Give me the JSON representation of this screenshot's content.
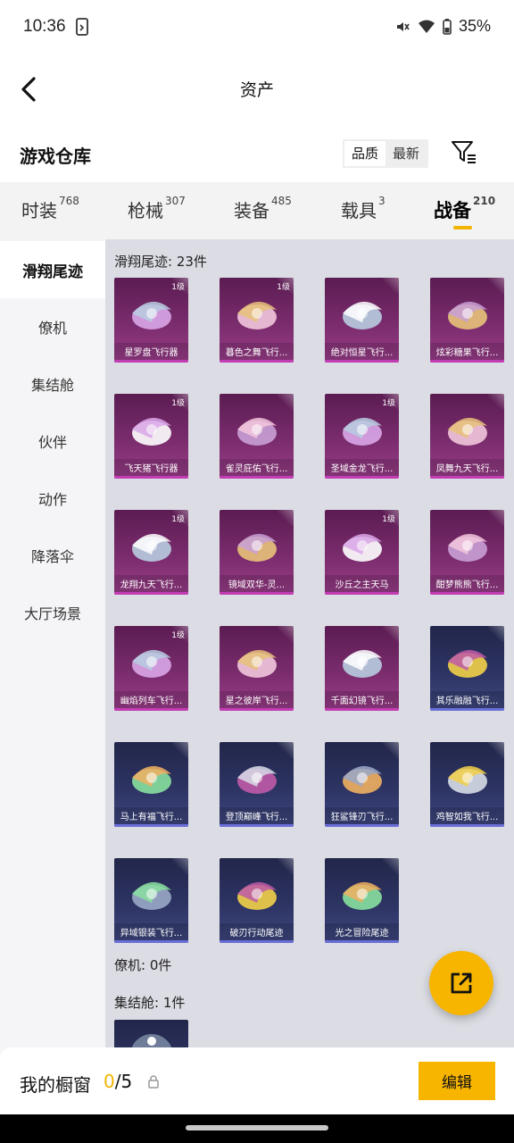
{
  "status": {
    "time": "10:36",
    "battery": "35%"
  },
  "header": {
    "title": "资产"
  },
  "repo": {
    "title": "游戏仓库",
    "sort_quality": "品质",
    "sort_latest": "最新"
  },
  "tabs": [
    {
      "label": "时装",
      "count": "768"
    },
    {
      "label": "枪械",
      "count": "307"
    },
    {
      "label": "装备",
      "count": "485"
    },
    {
      "label": "载具",
      "count": "3"
    },
    {
      "label": "战备",
      "count": "210"
    }
  ],
  "sidebar": {
    "items": [
      {
        "label": "滑翔尾迹"
      },
      {
        "label": "僚机"
      },
      {
        "label": "集结舱"
      },
      {
        "label": "伙伴"
      },
      {
        "label": "动作"
      },
      {
        "label": "降落伞"
      },
      {
        "label": "大厅场景"
      }
    ]
  },
  "sections": {
    "glide": {
      "title": "滑翔尾迹: 23件",
      "items": [
        {
          "name": "星罗盘飞行器",
          "level": "1级",
          "rarity": "purple",
          "icon": "compass-glider-icon"
        },
        {
          "name": "暮色之舞飞行...",
          "level": "1级",
          "rarity": "purple",
          "icon": "dusk-dance-glider-icon"
        },
        {
          "name": "绝对恒星飞行...",
          "level": "",
          "rarity": "purple",
          "icon": "star-orb-glider-icon"
        },
        {
          "name": "炫彩糖果飞行...",
          "level": "",
          "rarity": "purple",
          "icon": "candy-glider-icon"
        },
        {
          "name": "飞天猪飞行器",
          "level": "1级",
          "rarity": "purple",
          "icon": "flying-pig-glider-icon"
        },
        {
          "name": "雀灵庇佑飞行...",
          "level": "",
          "rarity": "purple",
          "icon": "sparrow-glider-icon"
        },
        {
          "name": "圣域金龙飞行...",
          "level": "1级",
          "rarity": "purple",
          "icon": "gold-dragon-glider-icon"
        },
        {
          "name": "凤舞九天飞行...",
          "level": "",
          "rarity": "purple",
          "icon": "phoenix-glider-icon"
        },
        {
          "name": "龙翔九天飞行...",
          "level": "1级",
          "rarity": "purple",
          "icon": "black-dragon-glider-icon"
        },
        {
          "name": "镜域双华-灵...",
          "level": "",
          "rarity": "purple",
          "icon": "mirror-wings-glider-icon"
        },
        {
          "name": "沙丘之主天马",
          "level": "1级",
          "rarity": "purple",
          "icon": "pegasus-glider-icon"
        },
        {
          "name": "酣梦熊熊飞行...",
          "level": "",
          "rarity": "purple",
          "icon": "bear-glider-icon"
        },
        {
          "name": "幽焰列车飞行...",
          "level": "1级",
          "rarity": "purple",
          "icon": "ghost-train-glider-icon"
        },
        {
          "name": "星之彼岸飞行...",
          "level": "",
          "rarity": "purple",
          "icon": "star-shore-glider-icon"
        },
        {
          "name": "千面幻镜飞行...",
          "level": "",
          "rarity": "purple",
          "icon": "ufo-glider-icon"
        },
        {
          "name": "其乐融融飞行...",
          "level": "",
          "rarity": "blue",
          "icon": "penguin-glider-icon"
        },
        {
          "name": "马上有福飞行...",
          "level": "",
          "rarity": "blue",
          "icon": "horse-glider-icon"
        },
        {
          "name": "登顶巅峰飞行...",
          "level": "",
          "rarity": "blue",
          "icon": "peak-glider-icon"
        },
        {
          "name": "狂鲨锋刃飞行...",
          "level": "",
          "rarity": "blue",
          "icon": "shark-glider-icon"
        },
        {
          "name": "鸡智如我飞行...",
          "level": "",
          "rarity": "blue",
          "icon": "chicken-glider-icon"
        },
        {
          "name": "异域银装飞行...",
          "level": "",
          "rarity": "blue",
          "icon": "silver-glider-icon"
        },
        {
          "name": "破刃行动尾迹",
          "level": "",
          "rarity": "blue",
          "icon": "rainbow-trail-icon"
        },
        {
          "name": "光之冒险尾迹",
          "level": "",
          "rarity": "blue",
          "icon": "green-trail-icon"
        }
      ]
    },
    "wingman": {
      "title": "僚机: 0件"
    },
    "capsule": {
      "title": "集结舱: 1件"
    }
  },
  "bottom": {
    "showcase_label": "我的橱窗",
    "showcase_used": "0",
    "showcase_total": "/5",
    "edit_label": "编辑"
  },
  "colors": {
    "accent": "#f7b500",
    "purple_rarity": "#c23db4",
    "blue_rarity": "#6a6fd8"
  }
}
